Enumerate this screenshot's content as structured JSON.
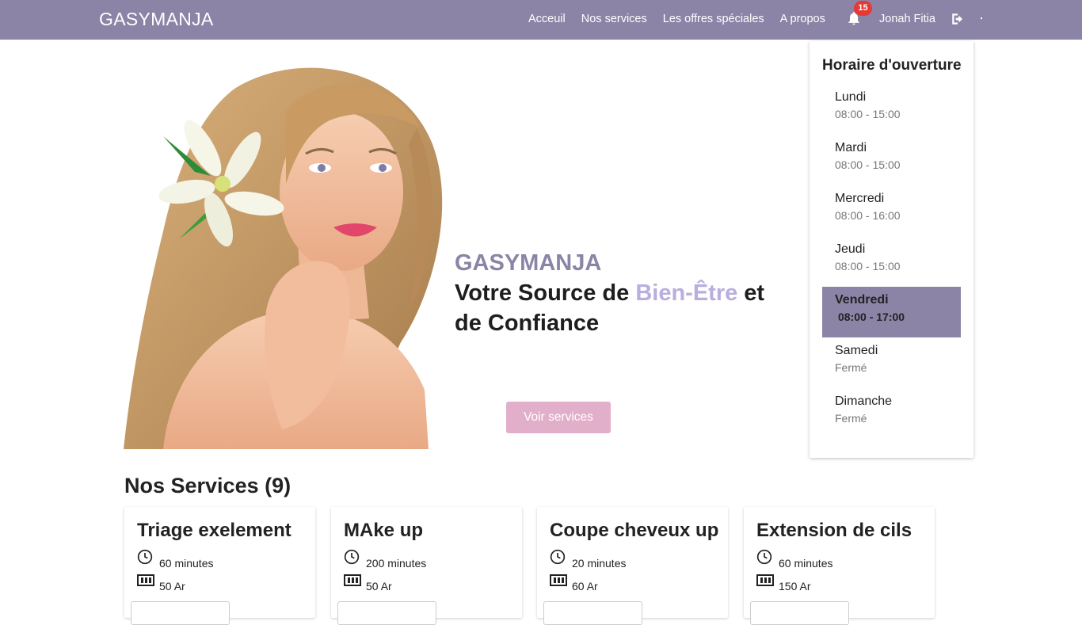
{
  "navbar": {
    "brand": "GASYMANJA",
    "links": [
      "Acceuil",
      "Nos services",
      "Les offres spéciales",
      "A propos"
    ],
    "notification_count": "15",
    "username": "Jonah Fitia",
    "bg_color": "#8b84a6"
  },
  "hero": {
    "brand": "GASYMANJA",
    "tagline_part1": "Votre Source de ",
    "tagline_accent": "Bien-Être",
    "tagline_part2": " et",
    "tagline_line2": "de Confiance",
    "button_label": "Voir services",
    "button_color": "#e2afcb"
  },
  "hours": {
    "title": "Horaire d'ouverture",
    "days": [
      {
        "day": "Lundi",
        "time": "08:00 - 15:00",
        "active": false
      },
      {
        "day": "Mardi",
        "time": "08:00 - 15:00",
        "active": false
      },
      {
        "day": "Mercredi",
        "time": "08:00 - 16:00",
        "active": false
      },
      {
        "day": "Jeudi",
        "time": "08:00 - 15:00",
        "active": false
      },
      {
        "day": "Vendredi",
        "time": "08:00 - 17:00",
        "active": true
      },
      {
        "day": "Samedi",
        "time": "Fermé",
        "active": false
      },
      {
        "day": "Dimanche",
        "time": "Fermé",
        "active": false
      }
    ]
  },
  "services": {
    "title": "Nos Services (9)",
    "items": [
      {
        "name": "Triage exelement",
        "duration": "60 minutes",
        "price": "50 Ar"
      },
      {
        "name": "MAke up",
        "duration": "200 minutes",
        "price": "50 Ar"
      },
      {
        "name": "Coupe cheveux up",
        "duration": "20 minutes",
        "price": "60 Ar"
      },
      {
        "name": "Extension de cils",
        "duration": "60 minutes",
        "price": "150 Ar"
      }
    ]
  },
  "icons": {
    "notification": "bell-icon",
    "logout": "logout-icon",
    "duration": "clock-icon",
    "price": "money-icon"
  }
}
